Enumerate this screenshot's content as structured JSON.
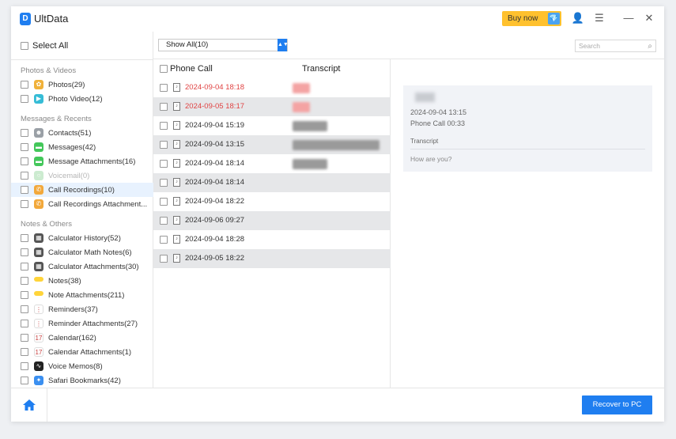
{
  "app": {
    "logo": "D",
    "title": "UltData"
  },
  "titlebar": {
    "buy_label": "Buy now",
    "buy_icon": "gem-icon",
    "account_icon": "user-icon",
    "menu_icon": "menu-icon",
    "minimize_icon": "minimize-icon",
    "close_icon": "close-icon",
    "account_glyph": "👤",
    "menu_glyph": "☰",
    "minimize_glyph": "—",
    "close_glyph": "✕",
    "buy_glyph": "💎"
  },
  "sidebar": {
    "select_all": "Select All",
    "sections": [
      {
        "title": "Photos & Videos"
      },
      {
        "title": "Messages & Recents"
      },
      {
        "title": "Notes & Others"
      }
    ],
    "items": [
      {
        "label": "Photos(29)",
        "icon": "photos-icon",
        "color": "#f0b13a",
        "glyph": "✿",
        "state": "normal"
      },
      {
        "label": "Photo Video(12)",
        "icon": "clapper-icon",
        "color": "#36bcd6",
        "glyph": "▶",
        "state": "normal"
      },
      {
        "label": "Contacts(51)",
        "icon": "contacts-icon",
        "color": "#9aa0a6",
        "glyph": "☻",
        "state": "normal"
      },
      {
        "label": "Messages(42)",
        "icon": "messages-icon",
        "color": "#43c75a",
        "glyph": "▬",
        "state": "normal"
      },
      {
        "label": "Message Attachments(16)",
        "icon": "message-attachment-icon",
        "color": "#43c75a",
        "glyph": "▬",
        "state": "normal"
      },
      {
        "label": "Voicemail(0)",
        "icon": "voicemail-icon",
        "color": "#b7e3bd",
        "glyph": "○",
        "state": "disabled"
      },
      {
        "label": "Call Recordings(10)",
        "icon": "call-recording-icon",
        "color": "#f2a83b",
        "glyph": "✆",
        "state": "selected"
      },
      {
        "label": "Call Recordings Attachment...",
        "icon": "call-attachment-icon",
        "color": "#f2a83b",
        "glyph": "✆",
        "state": "normal"
      },
      {
        "label": "Calculator History(52)",
        "icon": "calculator-icon",
        "color": "#555555",
        "glyph": "▦",
        "state": "normal"
      },
      {
        "label": "Calculator Math Notes(6)",
        "icon": "calculator-notes-icon",
        "color": "#555555",
        "glyph": "▦",
        "state": "normal"
      },
      {
        "label": "Calculator Attachments(30)",
        "icon": "calculator-attachment-icon",
        "color": "#555555",
        "glyph": "▦",
        "state": "normal"
      },
      {
        "label": "Notes(38)",
        "icon": "notes-icon",
        "color": "#ffd43a",
        "glyph": "",
        "state": "normal"
      },
      {
        "label": "Note Attachments(211)",
        "icon": "note-attachment-icon",
        "color": "#ffd43a",
        "glyph": "",
        "state": "normal"
      },
      {
        "label": "Reminders(37)",
        "icon": "reminders-icon",
        "color": "#ffffff",
        "glyph": "⋮",
        "state": "normal"
      },
      {
        "label": "Reminder Attachments(27)",
        "icon": "reminder-attachment-icon",
        "color": "#ffffff",
        "glyph": "⋮",
        "state": "normal"
      },
      {
        "label": "Calendar(162)",
        "icon": "calendar-icon",
        "color": "#ffffff",
        "glyph": "17",
        "state": "normal"
      },
      {
        "label": "Calendar Attachments(1)",
        "icon": "calendar-attachment-icon",
        "color": "#ffffff",
        "glyph": "17",
        "state": "normal"
      },
      {
        "label": "Voice Memos(8)",
        "icon": "voice-memo-icon",
        "color": "#222222",
        "glyph": "∿",
        "state": "normal"
      },
      {
        "label": "Safari Bookmarks(42)",
        "icon": "safari-icon",
        "color": "#3b8ff0",
        "glyph": "✦",
        "state": "normal"
      }
    ]
  },
  "filter": {
    "dropdown_value": "Show All(10)",
    "search_placeholder": "Search"
  },
  "list": {
    "col_call": "Phone Call",
    "col_transcript": "Transcript",
    "rows": [
      {
        "date": "2024-09-04 18:18",
        "highlight": true
      },
      {
        "date": "2024-09-05 18:17",
        "highlight": true
      },
      {
        "date": "2024-09-04 15:19",
        "highlight": false
      },
      {
        "date": "2024-09-04 13:15",
        "highlight": false
      },
      {
        "date": "2024-09-04 18:14",
        "highlight": false
      },
      {
        "date": "2024-09-04 18:14",
        "highlight": false
      },
      {
        "date": "2024-09-04 18:22",
        "highlight": false
      },
      {
        "date": "2024-09-06 09:27",
        "highlight": false
      },
      {
        "date": "2024-09-04 18:28",
        "highlight": false
      },
      {
        "date": "2024-09-05 18:22",
        "highlight": false
      }
    ]
  },
  "detail": {
    "date": "2024-09-04 13:15",
    "call_info": "Phone Call 00:33",
    "transcript_label": "Transcript",
    "transcript_text": "How are you?"
  },
  "bottom": {
    "home_icon": "home-icon",
    "recover_label": "Recover to PC"
  },
  "colors": {
    "accent": "#1f7ef0",
    "buy": "#ffc12e",
    "highlight_text": "#e04343",
    "selected_bg": "#e8f2fe"
  }
}
